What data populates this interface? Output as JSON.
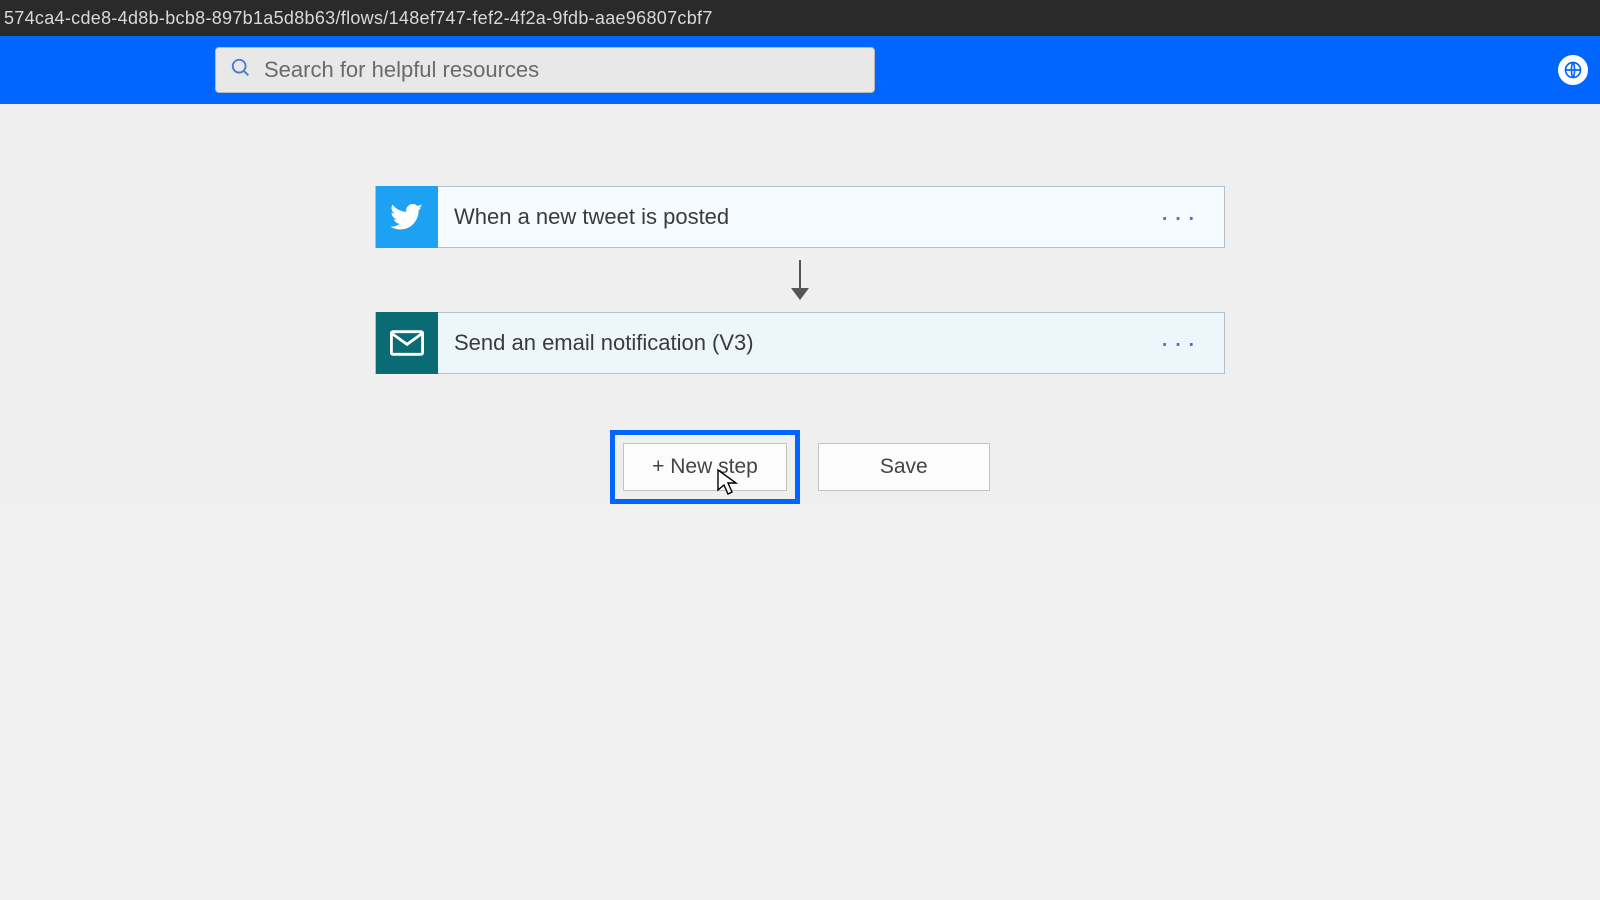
{
  "browser": {
    "url_fragment": "574ca4-cde8-4d8b-bcb8-897b1a5d8b63/flows/148ef747-fef2-4f2a-9fdb-aae96807cbf7"
  },
  "header": {
    "search_placeholder": "Search for helpful resources"
  },
  "flow": {
    "trigger": {
      "title": "When a new tweet is posted",
      "icon": "twitter-icon"
    },
    "actions": [
      {
        "title": "Send an email notification (V3)",
        "icon": "mail-icon"
      }
    ]
  },
  "buttons": {
    "new_step": "+ New step",
    "save": "Save"
  }
}
